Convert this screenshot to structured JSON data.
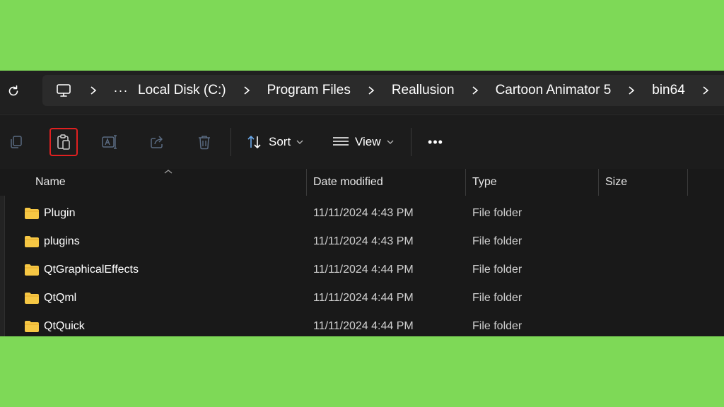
{
  "address_bar": {
    "breadcrumbs": [
      "Local Disk (C:)",
      "Program Files",
      "Reallusion",
      "Cartoon Animator 5",
      "bin64"
    ],
    "overflow_label": "···"
  },
  "toolbar": {
    "copy_icon": "copy-icon",
    "paste_icon": "paste-icon",
    "rename_icon": "rename-icon",
    "share_icon": "share-icon",
    "delete_icon": "delete-icon",
    "sort_label": "Sort",
    "view_label": "View",
    "more_label": "•••",
    "highlight_color": "#e02020"
  },
  "columns": {
    "name": "Name",
    "date": "Date modified",
    "type": "Type",
    "size": "Size"
  },
  "rows": [
    {
      "name": "Plugin",
      "date": "11/11/2024 4:43 PM",
      "type": "File folder"
    },
    {
      "name": "plugins",
      "date": "11/11/2024 4:43 PM",
      "type": "File folder"
    },
    {
      "name": "QtGraphicalEffects",
      "date": "11/11/2024 4:44 PM",
      "type": "File folder"
    },
    {
      "name": "QtQml",
      "date": "11/11/2024 4:44 PM",
      "type": "File folder"
    },
    {
      "name": "QtQuick",
      "date": "11/11/2024 4:44 PM",
      "type": "File folder"
    }
  ],
  "colors": {
    "background": "#7ed957",
    "folder": "#f6c744"
  }
}
